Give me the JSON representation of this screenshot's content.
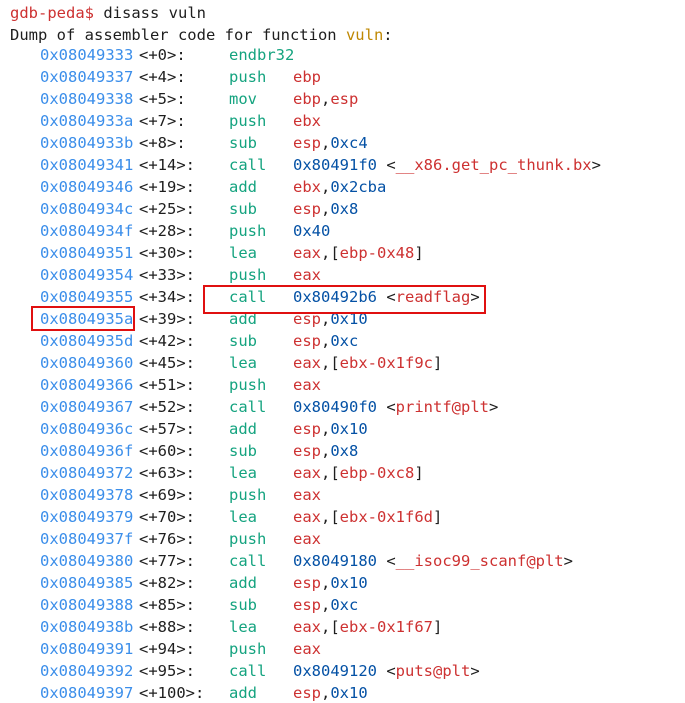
{
  "terminal": {
    "prompt": "gdb-peda$",
    "command": "disass vuln",
    "dump_prefix": "Dump of assembler code for function ",
    "dump_func": "vuln",
    "dump_suffix": ":",
    "highlight_color": "#e01010",
    "colors": {
      "address": "#3b8eea",
      "mnemonic": "#14a37f",
      "register": "#cd3131",
      "function_name": "#bf8803"
    },
    "rows": [
      {
        "addr": "0x08049333",
        "off": "<+0>:",
        "mn": "endbr32",
        "ops": []
      },
      {
        "addr": "0x08049337",
        "off": "<+4>:",
        "mn": "push",
        "ops": [
          [
            "reg",
            "ebp"
          ]
        ]
      },
      {
        "addr": "0x08049338",
        "off": "<+5>:",
        "mn": "mov",
        "ops": [
          [
            "reg",
            "ebp"
          ],
          [
            "punc",
            ","
          ],
          [
            "reg",
            "esp"
          ]
        ]
      },
      {
        "addr": "0x0804933a",
        "off": "<+7>:",
        "mn": "push",
        "ops": [
          [
            "reg",
            "ebx"
          ]
        ]
      },
      {
        "addr": "0x0804933b",
        "off": "<+8>:",
        "mn": "sub",
        "ops": [
          [
            "reg",
            "esp"
          ],
          [
            "punc",
            ","
          ],
          [
            "num",
            "0xc4"
          ]
        ]
      },
      {
        "addr": "0x08049341",
        "off": "<+14>:",
        "mn": "call",
        "ops": [
          [
            "num",
            "0x80491f0"
          ],
          [
            "punc",
            " <"
          ],
          [
            "sym",
            "__x86.get_pc_thunk.bx"
          ],
          [
            "punc",
            ">"
          ]
        ]
      },
      {
        "addr": "0x08049346",
        "off": "<+19>:",
        "mn": "add",
        "ops": [
          [
            "reg",
            "ebx"
          ],
          [
            "punc",
            ","
          ],
          [
            "num",
            "0x2cba"
          ]
        ]
      },
      {
        "addr": "0x0804934c",
        "off": "<+25>:",
        "mn": "sub",
        "ops": [
          [
            "reg",
            "esp"
          ],
          [
            "punc",
            ","
          ],
          [
            "num",
            "0x8"
          ]
        ]
      },
      {
        "addr": "0x0804934f",
        "off": "<+28>:",
        "mn": "push",
        "ops": [
          [
            "num",
            "0x40"
          ]
        ]
      },
      {
        "addr": "0x08049351",
        "off": "<+30>:",
        "mn": "lea",
        "ops": [
          [
            "reg",
            "eax"
          ],
          [
            "punc",
            ",["
          ],
          [
            "reg",
            "ebp-0x48"
          ],
          [
            "punc",
            "]"
          ]
        ]
      },
      {
        "addr": "0x08049354",
        "off": "<+33>:",
        "mn": "push",
        "ops": [
          [
            "reg",
            "eax"
          ]
        ]
      },
      {
        "addr": "0x08049355",
        "off": "<+34>:",
        "mn": "call",
        "ops": [
          [
            "num",
            "0x80492b6"
          ],
          [
            "punc",
            " <"
          ],
          [
            "sym",
            "readflag"
          ],
          [
            "punc",
            ">"
          ]
        ]
      },
      {
        "addr": "0x0804935a",
        "off": "<+39>:",
        "mn": "add",
        "ops": [
          [
            "reg",
            "esp"
          ],
          [
            "punc",
            ","
          ],
          [
            "num",
            "0x10"
          ]
        ]
      },
      {
        "addr": "0x0804935d",
        "off": "<+42>:",
        "mn": "sub",
        "ops": [
          [
            "reg",
            "esp"
          ],
          [
            "punc",
            ","
          ],
          [
            "num",
            "0xc"
          ]
        ]
      },
      {
        "addr": "0x08049360",
        "off": "<+45>:",
        "mn": "lea",
        "ops": [
          [
            "reg",
            "eax"
          ],
          [
            "punc",
            ",["
          ],
          [
            "reg",
            "ebx-0x1f9c"
          ],
          [
            "punc",
            "]"
          ]
        ]
      },
      {
        "addr": "0x08049366",
        "off": "<+51>:",
        "mn": "push",
        "ops": [
          [
            "reg",
            "eax"
          ]
        ]
      },
      {
        "addr": "0x08049367",
        "off": "<+52>:",
        "mn": "call",
        "ops": [
          [
            "num",
            "0x80490f0"
          ],
          [
            "punc",
            " <"
          ],
          [
            "sym",
            "printf@plt"
          ],
          [
            "punc",
            ">"
          ]
        ]
      },
      {
        "addr": "0x0804936c",
        "off": "<+57>:",
        "mn": "add",
        "ops": [
          [
            "reg",
            "esp"
          ],
          [
            "punc",
            ","
          ],
          [
            "num",
            "0x10"
          ]
        ]
      },
      {
        "addr": "0x0804936f",
        "off": "<+60>:",
        "mn": "sub",
        "ops": [
          [
            "reg",
            "esp"
          ],
          [
            "punc",
            ","
          ],
          [
            "num",
            "0x8"
          ]
        ]
      },
      {
        "addr": "0x08049372",
        "off": "<+63>:",
        "mn": "lea",
        "ops": [
          [
            "reg",
            "eax"
          ],
          [
            "punc",
            ",["
          ],
          [
            "reg",
            "ebp-0xc8"
          ],
          [
            "punc",
            "]"
          ]
        ]
      },
      {
        "addr": "0x08049378",
        "off": "<+69>:",
        "mn": "push",
        "ops": [
          [
            "reg",
            "eax"
          ]
        ]
      },
      {
        "addr": "0x08049379",
        "off": "<+70>:",
        "mn": "lea",
        "ops": [
          [
            "reg",
            "eax"
          ],
          [
            "punc",
            ",["
          ],
          [
            "reg",
            "ebx-0x1f6d"
          ],
          [
            "punc",
            "]"
          ]
        ]
      },
      {
        "addr": "0x0804937f",
        "off": "<+76>:",
        "mn": "push",
        "ops": [
          [
            "reg",
            "eax"
          ]
        ]
      },
      {
        "addr": "0x08049380",
        "off": "<+77>:",
        "mn": "call",
        "ops": [
          [
            "num",
            "0x8049180"
          ],
          [
            "punc",
            " <"
          ],
          [
            "sym",
            "__isoc99_scanf@plt"
          ],
          [
            "punc",
            ">"
          ]
        ]
      },
      {
        "addr": "0x08049385",
        "off": "<+82>:",
        "mn": "add",
        "ops": [
          [
            "reg",
            "esp"
          ],
          [
            "punc",
            ","
          ],
          [
            "num",
            "0x10"
          ]
        ]
      },
      {
        "addr": "0x08049388",
        "off": "<+85>:",
        "mn": "sub",
        "ops": [
          [
            "reg",
            "esp"
          ],
          [
            "punc",
            ","
          ],
          [
            "num",
            "0xc"
          ]
        ]
      },
      {
        "addr": "0x0804938b",
        "off": "<+88>:",
        "mn": "lea",
        "ops": [
          [
            "reg",
            "eax"
          ],
          [
            "punc",
            ",["
          ],
          [
            "reg",
            "ebx-0x1f67"
          ],
          [
            "punc",
            "]"
          ]
        ]
      },
      {
        "addr": "0x08049391",
        "off": "<+94>:",
        "mn": "push",
        "ops": [
          [
            "reg",
            "eax"
          ]
        ]
      },
      {
        "addr": "0x08049392",
        "off": "<+95>:",
        "mn": "call",
        "ops": [
          [
            "num",
            "0x8049120"
          ],
          [
            "punc",
            " <"
          ],
          [
            "sym",
            "puts@plt"
          ],
          [
            "punc",
            ">"
          ]
        ]
      },
      {
        "addr": "0x08049397",
        "off": "<+100>:",
        "mn": "add",
        "ops": [
          [
            "reg",
            "esp"
          ],
          [
            "punc",
            ","
          ],
          [
            "num",
            "0x10"
          ]
        ]
      }
    ]
  }
}
